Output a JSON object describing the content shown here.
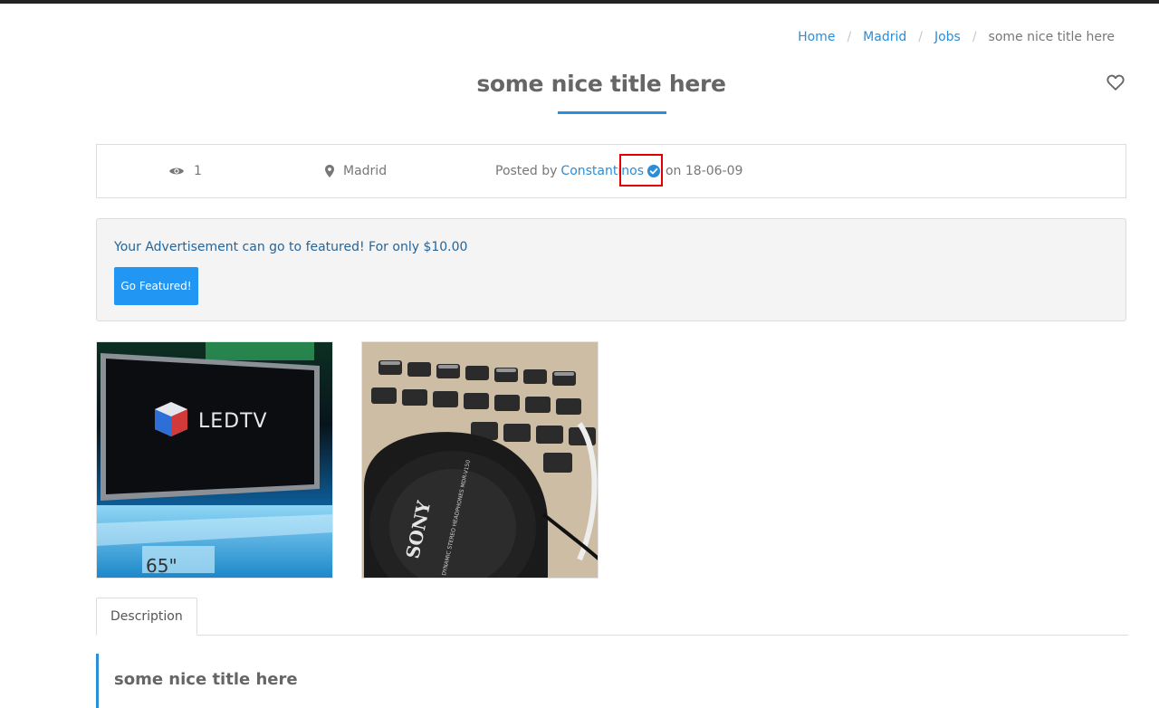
{
  "breadcrumb": {
    "items": [
      {
        "label": "Home"
      },
      {
        "label": "Madrid"
      },
      {
        "label": "Jobs"
      }
    ],
    "separator": "/",
    "current": "some nice title here"
  },
  "page": {
    "title": "some nice title here"
  },
  "info": {
    "views": "1",
    "location": "Madrid",
    "posted_prefix": "Posted by",
    "author": "Constantinos",
    "posted_suffix": "on 18-06-09"
  },
  "promo": {
    "text": "Your Advertisement can go to featured! For only $10.00",
    "button_label": "Go Featured!"
  },
  "gallery": {
    "image1_caption": "LEDTV",
    "image1_size": "65\"",
    "image2_brand": "SONY",
    "image2_detail": "DYNAMIC STEREO HEADPHONES MDR-V150"
  },
  "tabs": [
    {
      "label": "Description"
    }
  ],
  "description": {
    "title": "some nice title here"
  },
  "colors": {
    "accent": "#2a8ed8",
    "button": "#2196f3",
    "promo_text": "#24659a",
    "highlight": "#e00000"
  },
  "icons": {
    "views": "eye-icon",
    "location": "map-marker-icon",
    "verified": "verified-check-icon",
    "favorite": "heart-outline-icon"
  }
}
